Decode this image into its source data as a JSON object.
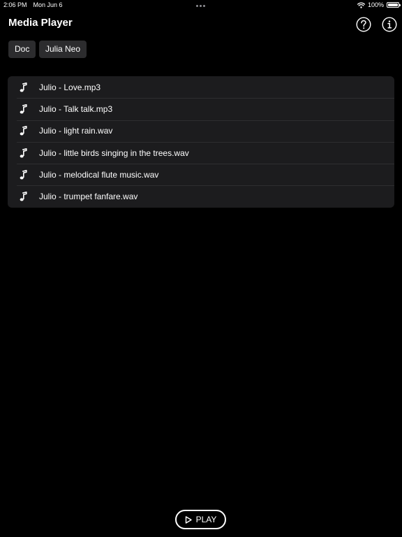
{
  "status_bar": {
    "time": "2:06 PM",
    "date": "Mon Jun 6",
    "battery": "100%",
    "battery_level": 1.0
  },
  "header": {
    "title": "Media Player",
    "help_icon": "question-circle-icon",
    "info_icon": "info-circle-icon"
  },
  "chips": [
    {
      "label": "Doc"
    },
    {
      "label": "Julia Neo"
    }
  ],
  "files": [
    {
      "name": "Julio - Love.mp3",
      "icon": "music-note-icon"
    },
    {
      "name": "Julio - Talk talk.mp3",
      "icon": "music-note-icon"
    },
    {
      "name": "Julio - light rain.wav",
      "icon": "music-note-icon"
    },
    {
      "name": "Julio - little birds singing in the trees.wav",
      "icon": "music-note-icon"
    },
    {
      "name": "Julio - melodical flute music.wav",
      "icon": "music-note-icon"
    },
    {
      "name": "Julio - trumpet fanfare.wav",
      "icon": "music-note-icon"
    }
  ],
  "player": {
    "play_label": "PLAY",
    "play_icon": "play-icon"
  },
  "colors": {
    "background": "#000000",
    "list_background": "#1c1c1e",
    "chip_background": "#2c2c2e",
    "text": "#ffffff"
  }
}
